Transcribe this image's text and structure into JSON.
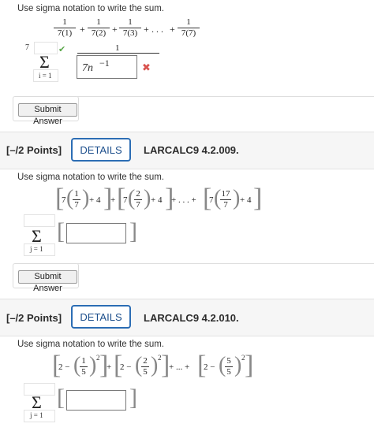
{
  "q1": {
    "instruction": "Use sigma notation to write the sum.",
    "terms": [
      {
        "num": "1",
        "den": "7(1)"
      },
      {
        "num": "1",
        "den": "7(2)"
      },
      {
        "num": "1",
        "den": "7(3)"
      },
      {
        "num": "1",
        "den": "7(7)"
      }
    ],
    "plus": "+",
    "dots": ". . .",
    "upper": "7",
    "lower": "i = 1",
    "answer_num": "1",
    "answer_den": "7n",
    "answer_exp": "−1",
    "correct_mark": "✔",
    "wrong_mark": "✖",
    "submit": "Submit Answer"
  },
  "q2": {
    "points": "[–/2 Points]",
    "details": "DETAILS",
    "code": "LARCALC9 4.2.009.",
    "instruction": "Use sigma notation to write the sum.",
    "seven": "7",
    "plus4": "+ 4",
    "term1": {
      "num": "1",
      "den": "7"
    },
    "term2": {
      "num": "2",
      "den": "7"
    },
    "term3": {
      "num": "17",
      "den": "7"
    },
    "plus": "+",
    "dots": "+ . . . +",
    "lower": "j = 1",
    "submit": "Submit Answer"
  },
  "q3": {
    "points": "[–/2 Points]",
    "details": "DETAILS",
    "code": "LARCALC9 4.2.010.",
    "instruction": "Use sigma notation to write the sum.",
    "two_minus": "2 −",
    "term1": {
      "num": "1",
      "den": "5"
    },
    "term2": {
      "num": "2",
      "den": "5"
    },
    "term3": {
      "num": "5",
      "den": "5"
    },
    "exp": "2",
    "plus": "+",
    "dots": "+ ... +",
    "lower": "j = 1"
  },
  "colors": {
    "accent": "#2c6db4",
    "check": "#5aa84a",
    "wrong": "#d9534f"
  }
}
